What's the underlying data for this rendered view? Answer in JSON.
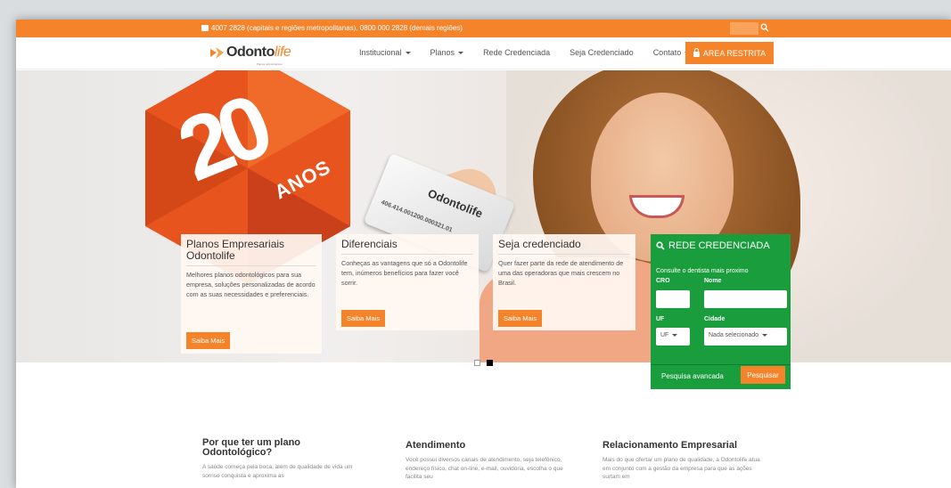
{
  "topbar": {
    "phone_text": "4007 2828 (capitais e regiões metropolitanas), 0800 000 2828 (demais regiões)"
  },
  "brand": {
    "logo_main": "Odonto",
    "logo_accent": "life",
    "logo_sub": "Planos odontológicos"
  },
  "nav": {
    "items": [
      {
        "label": "Institucional",
        "dropdown": true
      },
      {
        "label": "Planos",
        "dropdown": true
      },
      {
        "label": "Rede Credenciada",
        "dropdown": false
      },
      {
        "label": "Seja Credenciado",
        "dropdown": false
      },
      {
        "label": "Contato",
        "dropdown": true
      }
    ],
    "area_restrita": "AREA RESTRITA"
  },
  "hero": {
    "badge_number": "20",
    "badge_word": "ANOS",
    "card_logo": "Odontolife",
    "card_number": "406.414.001200.000321.01"
  },
  "cards": [
    {
      "title": "Planos Empresariais Odontolife",
      "text": "Melhores planos odontológicos para sua empresa, soluções personalizadas de acordo com as suas necessidades e preferenciais.",
      "button": "Saiba Mais"
    },
    {
      "title": "Diferenciais",
      "text": "Conheças as vantagens que só a Odontolife tem, inúmeros benefícios para fazer você sorrir.",
      "button": "Saiba Mais"
    },
    {
      "title": "Seja credenciado",
      "text": "Quer fazer parte da rede de atendimento de uma das operadoras que mais crescem no Brasil.",
      "button": "Saiba Mais"
    }
  ],
  "rede": {
    "title": "REDE CREDENCIADA",
    "subtitle": "Consulte o dentista mais proximo",
    "cro_label": "CRO",
    "nome_label": "Nome",
    "uf_label": "UF",
    "cidade_label": "Cidade",
    "uf_value": "UF",
    "cidade_value": "Nada selecionado",
    "advanced": "Pesquisa avancada",
    "search_button": "Pesquisar"
  },
  "bottom": [
    {
      "title": "Por que ter um plano Odontológico?",
      "text": "A saúde começa pela boca, além de qualidade de vida um sorriso conquista e aproxima as"
    },
    {
      "title": "Atendimento",
      "text": "Você possui diversos canais de atendimento, seja telefônico, endereço físico, chat on-line, e-mail, ouvidoria, escolha o que facilita seu"
    },
    {
      "title": "Relacionamento Empresarial",
      "text": "Mais do que ofertar um plano de qualidade, a Odontolife atua em conjunto com a gestão da empresa para que as ações surtam em"
    }
  ],
  "colors": {
    "accent": "#f5832a",
    "green": "#1a9d3d"
  }
}
